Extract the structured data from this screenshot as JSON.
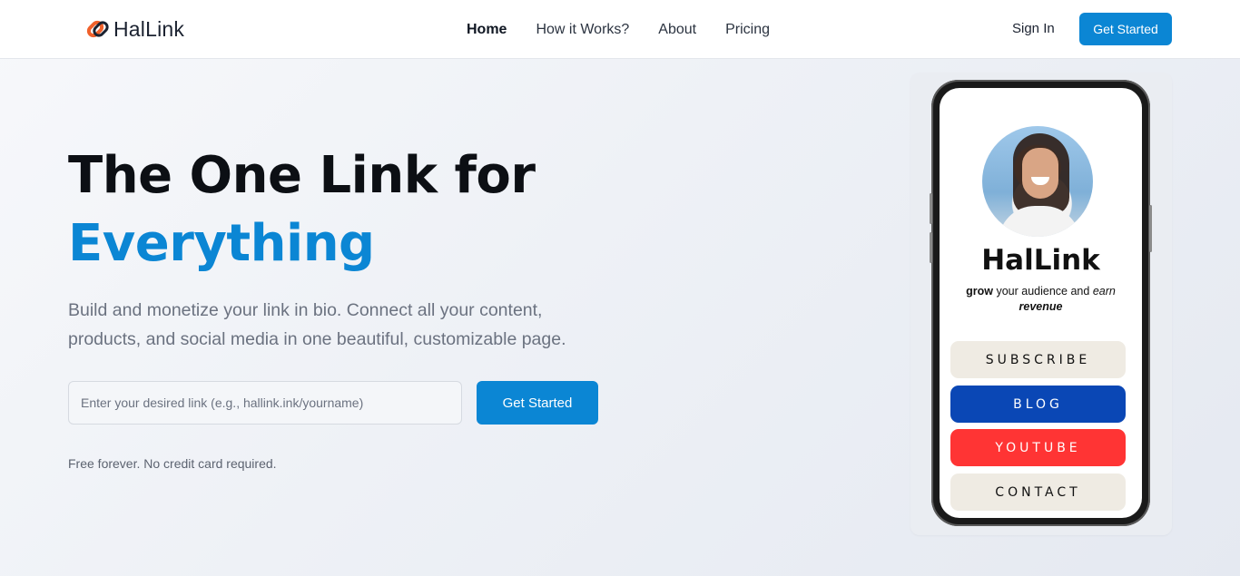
{
  "header": {
    "brand": "HalLink",
    "nav": [
      {
        "label": "Home",
        "active": true
      },
      {
        "label": "How it Works?",
        "active": false
      },
      {
        "label": "About",
        "active": false
      },
      {
        "label": "Pricing",
        "active": false
      }
    ],
    "sign_in": "Sign In",
    "cta": "Get Started"
  },
  "hero": {
    "title_line1": "The One Link for",
    "title_accent": "Everything",
    "subtitle": "Build and monetize your link in bio. Connect all your content, products, and social media in one beautiful, customizable page.",
    "input_placeholder": "Enter your desired link (e.g., hallink.ink/yourname)",
    "cta": "Get Started",
    "fine_print": "Free forever. No credit card required."
  },
  "mockup": {
    "profile_name": "HalLink",
    "bio_bold": "grow",
    "bio_mid": " your audience and ",
    "bio_italic": "earn",
    "bio_end_bold": "revenue",
    "links": [
      {
        "label": "SUBSCRIBE",
        "bg": "#efebe3",
        "color": "#111111"
      },
      {
        "label": "BLOG",
        "bg": "#0a47b5",
        "color": "#ffffff"
      },
      {
        "label": "YOUTUBE",
        "bg": "#ff3434",
        "color": "#ffffff"
      },
      {
        "label": "CONTACT",
        "bg": "#efebe3",
        "color": "#111111"
      }
    ]
  },
  "colors": {
    "accent": "#0b86d4",
    "logo_orange": "#f0612b"
  },
  "icons": {
    "logo": "chain-link-icon"
  }
}
